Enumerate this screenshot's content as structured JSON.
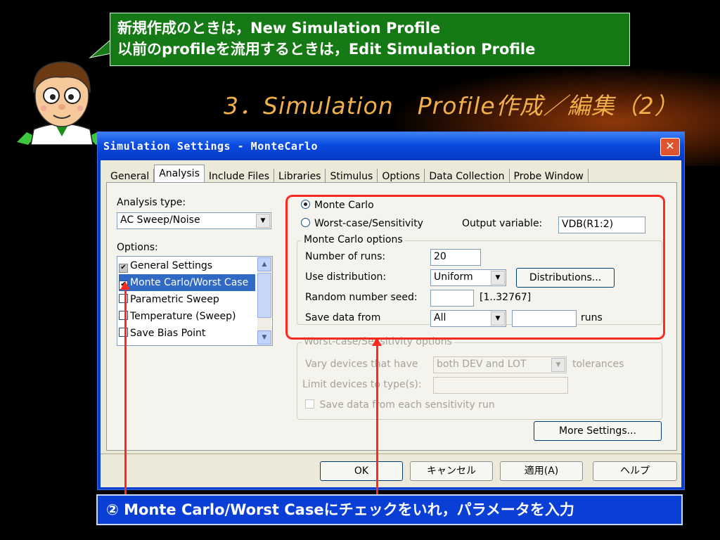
{
  "callout": {
    "line1": "新規作成のときは，New Simulation Profile",
    "line2": "以前のprofileを流用するときは，Edit Simulation Profile"
  },
  "slide_title": "3．Simulation　Profile作成／編集（2）",
  "window": {
    "title": "Simulation Settings - MonteCarlo",
    "close": "✕",
    "tabs": [
      "General",
      "Analysis",
      "Include Files",
      "Libraries",
      "Stimulus",
      "Options",
      "Data Collection",
      "Probe Window"
    ],
    "active_tab": "Analysis"
  },
  "analysis": {
    "type_label": "Analysis type:",
    "type_value": "AC Sweep/Noise",
    "options_label": "Options:",
    "options": [
      {
        "label": "General Settings",
        "checked": true,
        "gray": true,
        "selected": false
      },
      {
        "label": "Monte Carlo/Worst Case",
        "checked": true,
        "gray": false,
        "selected": true
      },
      {
        "label": "Parametric Sweep",
        "checked": false,
        "gray": false,
        "selected": false
      },
      {
        "label": "Temperature (Sweep)",
        "checked": false,
        "gray": false,
        "selected": false
      },
      {
        "label": "Save Bias Point",
        "checked": false,
        "gray": false,
        "selected": false
      }
    ]
  },
  "monte": {
    "radio_mc": "Monte Carlo",
    "radio_wc": "Worst-case/Sensitivity",
    "output_label": "Output variable:",
    "output_value": "VDB(R1:2)",
    "group_title": "Monte Carlo options",
    "runs_label": "Number of runs:",
    "runs_value": "20",
    "dist_label": "Use distribution:",
    "dist_value": "Uniform",
    "dist_button": "Distributions...",
    "seed_label": "Random number seed:",
    "seed_value": "",
    "seed_range": "[1..32767]",
    "save_label": "Save data from",
    "save_value": "All",
    "save_runs_value": "",
    "runs_suffix": "runs"
  },
  "worst": {
    "group_title": "Worst-case/Sensitivity options",
    "vary_label": "Vary devices that have",
    "vary_value": "both DEV and LOT",
    "tol_label": "tolerances",
    "limit_label": "Limit devices to type(s):",
    "limit_value": "",
    "save_each": "Save data from each sensitivity run"
  },
  "more_settings": "More Settings...",
  "buttons": {
    "ok": "OK",
    "cancel": "キャンセル",
    "apply": "適用(A)",
    "help": "ヘルプ"
  },
  "instruction": "②  Monte Carlo/Worst Caseにチェックをいれ，パラメータを入力",
  "colors": {
    "callout_bg": "#157a15",
    "title_color": "#f2b04a",
    "highlight": "#ff2a1f",
    "selection": "#316ac5",
    "instruction_bg": "#0a3fd6"
  }
}
